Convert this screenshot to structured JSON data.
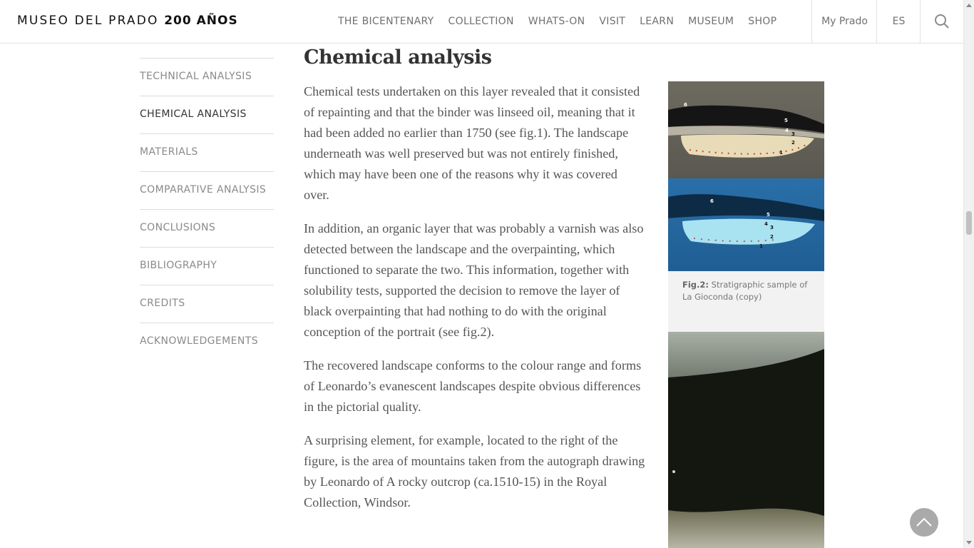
{
  "header": {
    "logo_light": "MUSEO DEL PRADO",
    "logo_bold": "200 AÑOS",
    "nav": [
      "THE BICENTENARY",
      "COLLECTION",
      "WHATS-ON",
      "VISIT",
      "LEARN",
      "MUSEUM",
      "SHOP"
    ],
    "my_prado": "My Prado",
    "language": "ES",
    "search_icon": "search-icon"
  },
  "sidenav": {
    "items": [
      {
        "label": "TECHNICAL ANALYSIS",
        "active": false
      },
      {
        "label": "CHEMICAL ANALYSIS",
        "active": true
      },
      {
        "label": "MATERIALS",
        "active": false
      },
      {
        "label": "COMPARATIVE ANALYSIS",
        "active": false
      },
      {
        "label": "CONCLUSIONS",
        "active": false
      },
      {
        "label": "BIBLIOGRAPHY",
        "active": false
      },
      {
        "label": "CREDITS",
        "active": false
      },
      {
        "label": "ACKNOWLEDGEMENTS",
        "active": false
      }
    ]
  },
  "article": {
    "title": "Chemical analysis",
    "paragraphs": [
      "Chemical tests undertaken on this layer revealed that it consisted of repainting and that the binder was linseed oil, meaning that it had been added no earlier than 1750 (see fig.1). The landscape underneath was well preserved but was not entirely finished, which may have been one of the reasons why it was covered over.",
      "In addition, an organic layer that was probably a varnish was also detected between the landscape and the overpainting, which functioned to separate the two. This information, together with solubility tests, supported the decision to remove the layer of black overpainting that had nothing to do with the original conception of the portrait (see fig.2).",
      "The recovered landscape conforms to the colour range and forms of Leonardo’s evanescent landscapes despite obvious differences in the pictorial quality.",
      "A surprising element, for example, located to the right of the figure, is the area of mountains taken from the autograph drawing by Leonardo of A rocky outcrop (ca.1510-15) in the Royal Collection, Windsor."
    ]
  },
  "figure2": {
    "caption_label": "Fig.2:",
    "caption_text": "Stratigraphic sample of La Gioconda (copy)",
    "layer_labels_top": [
      "6",
      "5",
      "4",
      "3",
      "2",
      "1"
    ],
    "layer_labels_bottom": [
      "6",
      "5",
      "4",
      "3",
      "2",
      "1"
    ]
  },
  "colors": {
    "nav_text": "#707070",
    "body_text": "#555555",
    "border": "#e2e2e2",
    "caption_bg": "#f2f2f2",
    "back_to_top": "#aaaaaa"
  },
  "icons": {
    "back_to_top": "chevron-up-icon"
  }
}
